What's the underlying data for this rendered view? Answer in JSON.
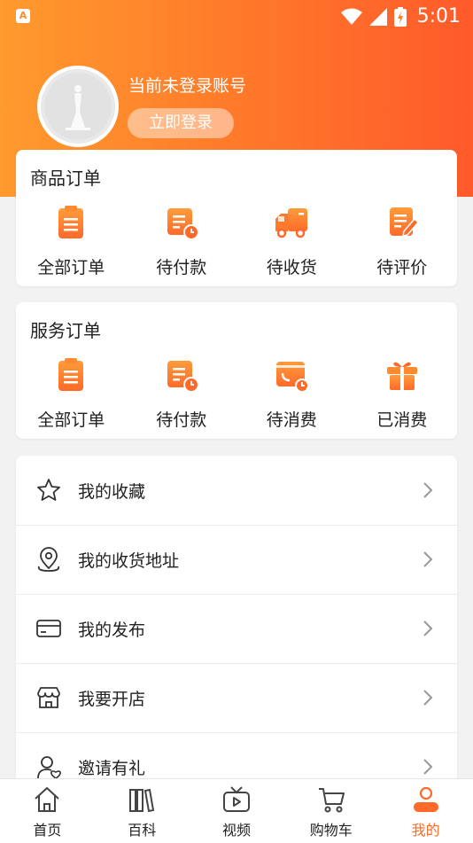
{
  "status_bar": {
    "time": "5:01"
  },
  "profile": {
    "login_hint": "当前未登录账号",
    "login_button": "立即登录"
  },
  "product_orders": {
    "title": "商品订单",
    "items": [
      {
        "label": "全部订单",
        "icon": "all-orders-icon"
      },
      {
        "label": "待付款",
        "icon": "pending-payment-icon"
      },
      {
        "label": "待收货",
        "icon": "pending-delivery-icon"
      },
      {
        "label": "待评价",
        "icon": "pending-review-icon"
      }
    ]
  },
  "service_orders": {
    "title": "服务订单",
    "items": [
      {
        "label": "全部订单",
        "icon": "all-orders-icon"
      },
      {
        "label": "待付款",
        "icon": "pending-payment-icon"
      },
      {
        "label": "待消费",
        "icon": "pending-consumption-icon"
      },
      {
        "label": "已消费",
        "icon": "consumed-gift-icon"
      }
    ]
  },
  "menu": [
    {
      "label": "我的收藏",
      "icon": "star-icon"
    },
    {
      "label": "我的收货地址",
      "icon": "location-icon"
    },
    {
      "label": "我的发布",
      "icon": "card-icon"
    },
    {
      "label": "我要开店",
      "icon": "store-icon"
    },
    {
      "label": "邀请有礼",
      "icon": "invite-icon"
    }
  ],
  "tabbar": [
    {
      "label": "首页",
      "icon": "home-icon",
      "active": false
    },
    {
      "label": "百科",
      "icon": "books-icon",
      "active": false
    },
    {
      "label": "视频",
      "icon": "tv-play-icon",
      "active": false
    },
    {
      "label": "购物车",
      "icon": "cart-icon",
      "active": false
    },
    {
      "label": "我的",
      "icon": "profile-icon",
      "active": true
    }
  ],
  "colors": {
    "accent": "#ff6a2a",
    "gradient_start": "#ff9a2e",
    "gradient_end": "#ff5a2a"
  }
}
